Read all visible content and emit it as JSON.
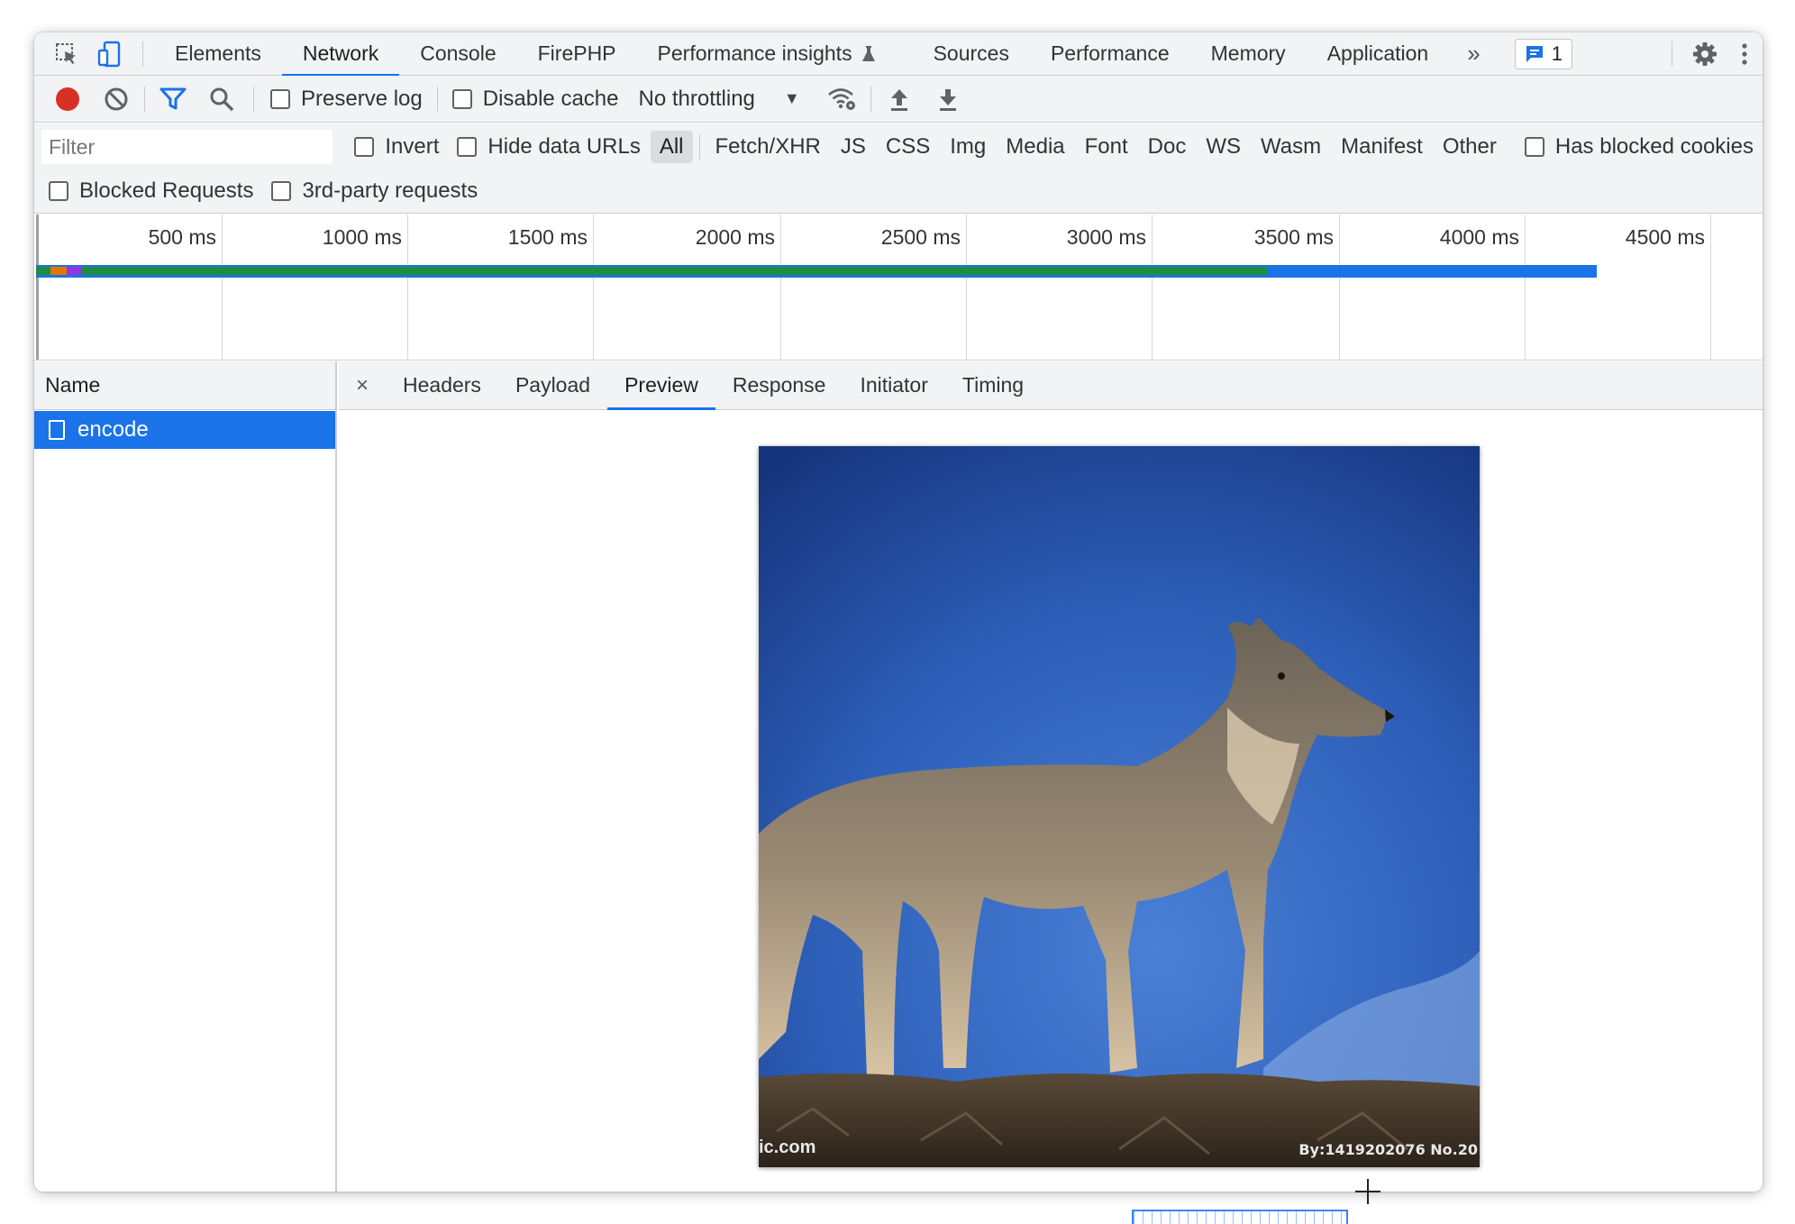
{
  "tabs": [
    "Elements",
    "Network",
    "Console",
    "FirePHP",
    "Performance insights",
    "Sources",
    "Performance",
    "Memory",
    "Application"
  ],
  "active_tab": "Network",
  "issues_count": "1",
  "toolbar": {
    "preserve_log": "Preserve log",
    "disable_cache": "Disable cache",
    "throttling": "No throttling"
  },
  "filter": {
    "placeholder": "Filter",
    "invert": "Invert",
    "hide_data_urls": "Hide data URLs",
    "types": [
      "All",
      "Fetch/XHR",
      "JS",
      "CSS",
      "Img",
      "Media",
      "Font",
      "Doc",
      "WS",
      "Wasm",
      "Manifest",
      "Other"
    ],
    "active_type": "All",
    "has_blocked_cookies": "Has blocked cookies",
    "blocked_requests": "Blocked Requests",
    "third_party": "3rd-party requests"
  },
  "overview": {
    "time_labels": [
      "500 ms",
      "1000 ms",
      "1500 ms",
      "2000 ms",
      "2500 ms",
      "3000 ms",
      "3500 ms",
      "4000 ms",
      "4500 ms"
    ]
  },
  "requests": {
    "header": "Name",
    "items": [
      {
        "name": "encode"
      }
    ]
  },
  "detail": {
    "close": "×",
    "tabs": [
      "Headers",
      "Payload",
      "Preview",
      "Response",
      "Initiator",
      "Timing"
    ],
    "active_tab": "Preview"
  },
  "preview": {
    "watermark_left": "ic.com",
    "watermark_right": "By:1419202076  No.20"
  },
  "colors": {
    "accent": "#1a73e8",
    "record": "#d93025",
    "bar_green": "#1e8e3e",
    "bar_blue": "#1a73e8"
  }
}
